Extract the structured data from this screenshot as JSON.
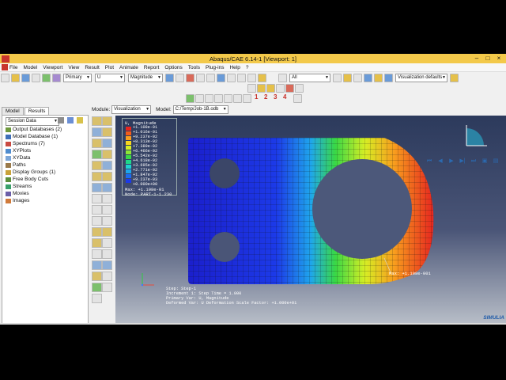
{
  "window": {
    "title": "Abaqus/CAE 6.14-1 [Viewport: 1]"
  },
  "menu": [
    "File",
    "Model",
    "Viewport",
    "View",
    "Result",
    "Plot",
    "Animate",
    "Report",
    "Options",
    "Tools",
    "Plug-ins",
    "Help",
    "?"
  ],
  "toolbar": {
    "primary_select": "Primary",
    "var_select": "U",
    "invariant_select": "Magnitude",
    "selection_select": "All",
    "defaults_select": "Visualization defaults"
  },
  "toolbar_numbers": [
    "1",
    "2",
    "3",
    "4"
  ],
  "module_bar": {
    "module_label": "Module:",
    "module_value": "Visualization",
    "model_label": "Model:",
    "model_value": "C:/Temp/Job-1B.odb"
  },
  "tabs": [
    "Model",
    "Results"
  ],
  "session_select": "Session Data",
  "tree": [
    "Output Databases (2)",
    "Model Database (1)",
    "Spectrums (7)",
    "XYPlots",
    "XYData",
    "Paths",
    "Display Groups (1)",
    "Free Body Cuts",
    "Streams",
    "Movies",
    "Images"
  ],
  "legend": {
    "title": "U, Magnitude",
    "values": [
      "+1.108e-01",
      "+1.016e-01",
      "+9.237e-02",
      "+8.313e-02",
      "+7.389e-02",
      "+6.466e-02",
      "+5.542e-02",
      "+4.618e-02",
      "+3.695e-02",
      "+2.771e-02",
      "+1.847e-02",
      "+9.237e-03",
      "+0.000e+00"
    ],
    "colors": [
      "#e6261f",
      "#f25b1a",
      "#f89d1e",
      "#f7d51d",
      "#d6ee24",
      "#8ee635",
      "#39d845",
      "#1fd889",
      "#1ed3cf",
      "#1fa6ec",
      "#1d6bf0",
      "#1c3ae8",
      "#1b1fcc"
    ],
    "max_line": "Max: +1.108e-01",
    "node_line": "Node: PART-1-1.230"
  },
  "step_info": [
    "Step: Step-1",
    "Increment    1: Step Time =    1.000",
    "Primary Var: U, Magnitude",
    "Deformed Var: U   Deformation Scale Factor: +1.000e+01"
  ],
  "max_label": "Max: +1.108e-001",
  "brand": "SIMULIA"
}
